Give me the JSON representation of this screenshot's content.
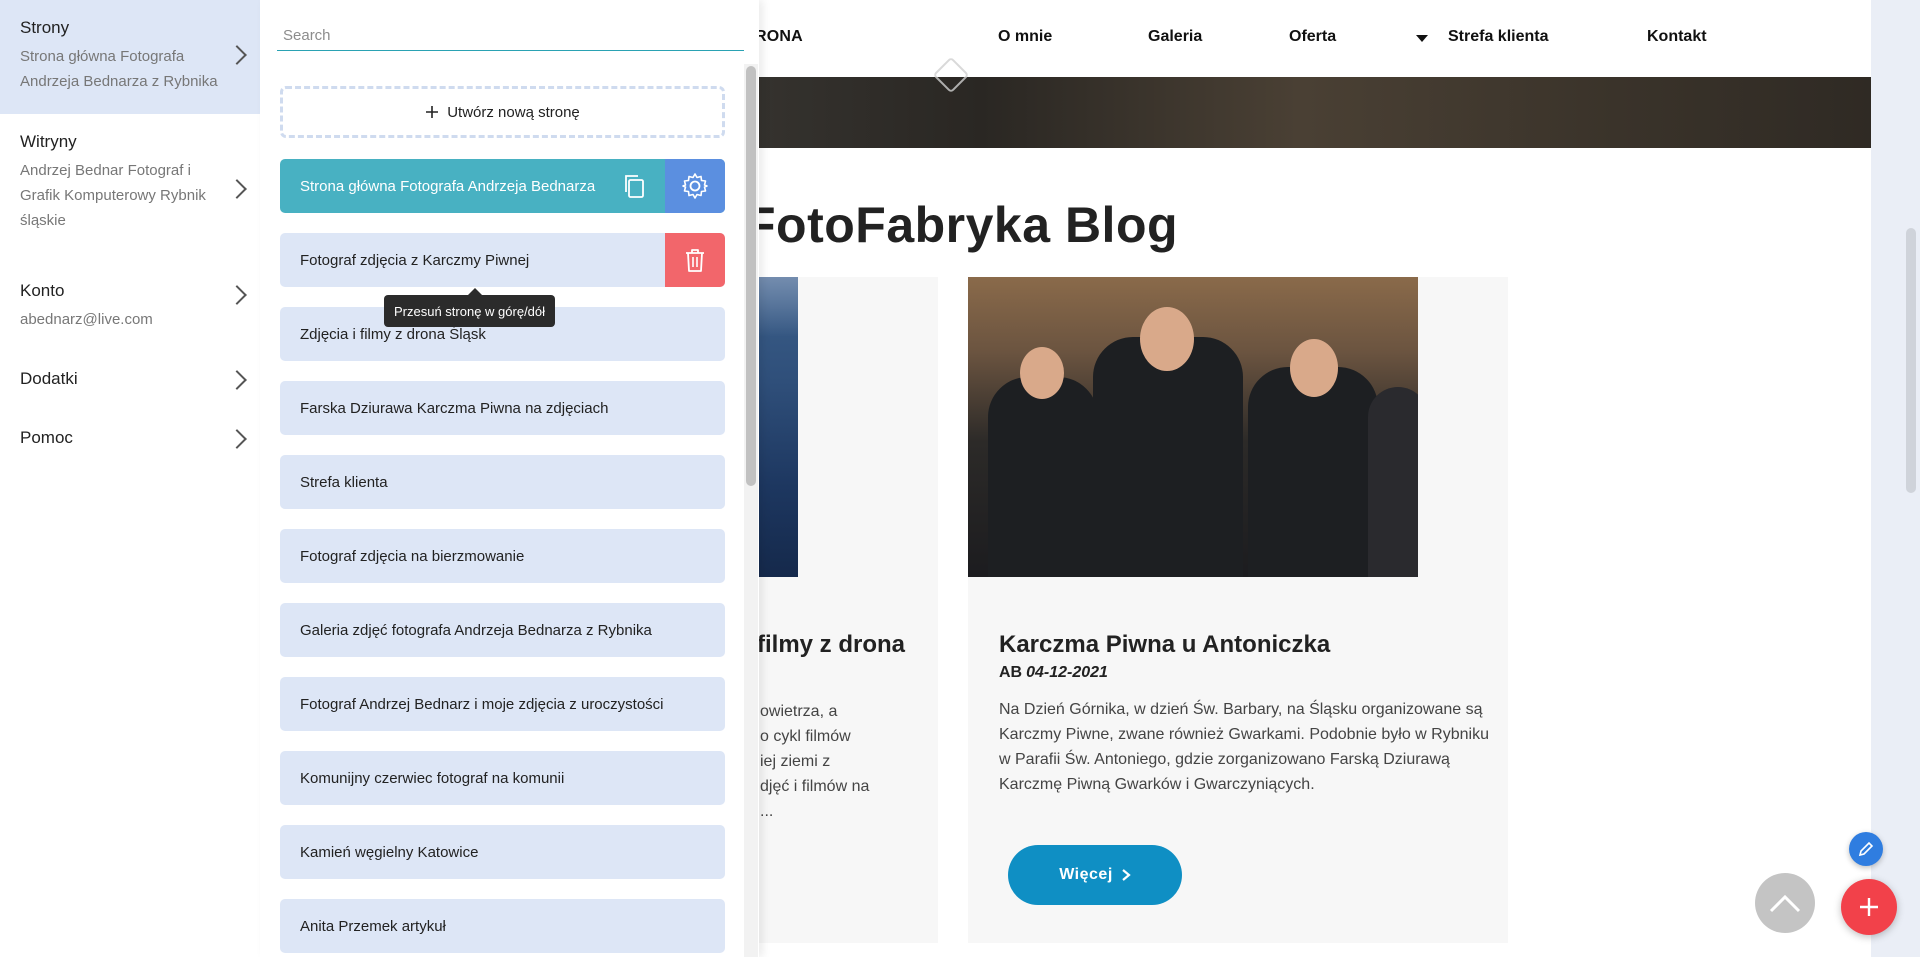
{
  "left_nav": {
    "sections": [
      {
        "title": "Strony",
        "subtitle": "Strona główna Fotografa Andrzeja Bednarza z Rybnika"
      },
      {
        "title": "Witryny",
        "subtitle": "Andrzej Bednar Fotograf i Grafik Komputerowy Rybnik śląskie"
      },
      {
        "title": "Konto",
        "subtitle": "abednarz@live.com"
      },
      {
        "title": "Dodatki",
        "subtitle": ""
      },
      {
        "title": "Pomoc",
        "subtitle": ""
      }
    ]
  },
  "pages_panel": {
    "search_placeholder": "Search",
    "new_page_label": "Utwórz nową stronę",
    "tooltip": "Przesuń stronę w górę/dół",
    "pages": [
      "Strona główna Fotografa Andrzeja Bednarza",
      "Fotograf zdjęcia z Karczmy Piwnej",
      "Zdjęcia i filmy z drona Śląsk",
      "Farska Dziurawa Karczma Piwna na zdjęciach",
      "Strefa klienta",
      "Fotograf zdjęcia na bierzmowanie",
      "Galeria zdjęć fotografa Andrzeja Bednarza z Rybnika",
      "Fotograf Andrzej Bednarz i moje zdjęcia z uroczystości",
      "Komunijny czerwiec fotograf na komunii",
      "Kamień węgielny Katowice",
      "Anita Przemek artykuł"
    ]
  },
  "site": {
    "nav": {
      "brand": "RONA",
      "items": [
        "O mnie",
        "Galeria",
        "Oferta",
        "Strefa klienta",
        "Kontakt"
      ]
    },
    "blog_title": "FotoFabryka Blog",
    "card_left": {
      "title": "filmy z drona",
      "text_lines": [
        "owietrza, a",
        "o cykl filmów",
        "iej ziemi z",
        "djęć i filmów na",
        "..."
      ]
    },
    "card_right": {
      "title": "Karczma Piwna u Antoniczka",
      "author": "AB",
      "date": "04-12-2021",
      "text": "Na Dzień Górnika, w dzień Św. Barbary, na Śląsku organizowane są Karczmy Piwne, zwane również Gwarkami. Podobnie było w Rybniku w Parafii Św. Antoniego, gdzie zorganizowano Farską Dziurawą Karczmę Piwną Gwarków i Gwarczyniących.",
      "more_label": "Więcej"
    }
  },
  "colors": {
    "accent_teal": "#48b1c2",
    "settings_blue": "#5b8fe0",
    "delete_red": "#f2666b",
    "button_blue": "#0f8fc4",
    "fab_red": "#f2414a"
  }
}
